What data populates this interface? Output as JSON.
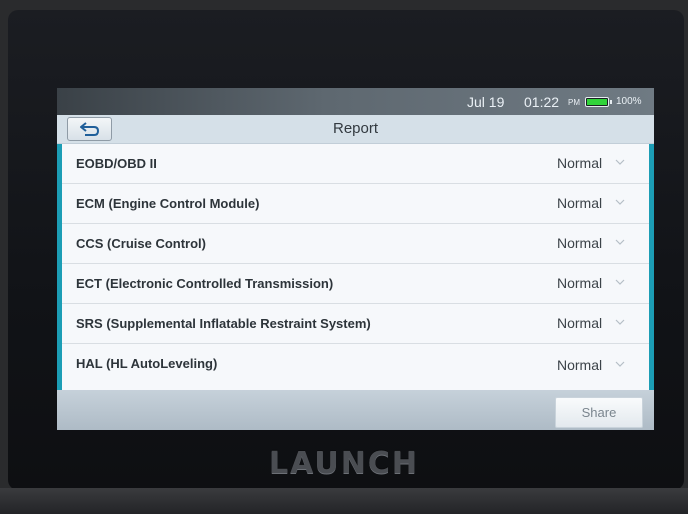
{
  "status_bar": {
    "date": "Jul 19",
    "time": "01:22",
    "ampm": "PM",
    "battery": "100%",
    "battery_icon": "battery-icon",
    "battery_color": "#31d33a"
  },
  "header": {
    "title": "Report",
    "back_icon": "back-arrow-icon"
  },
  "systems": [
    {
      "label": "EOBD/OBD II",
      "status": "Normal"
    },
    {
      "label": "ECM (Engine Control Module)",
      "status": "Normal"
    },
    {
      "label": "CCS (Cruise Control)",
      "status": "Normal"
    },
    {
      "label": "ECT (Electronic Controlled Transmission)",
      "status": "Normal"
    },
    {
      "label": "SRS (Supplemental Inflatable Restraint System)",
      "status": "Normal"
    },
    {
      "label": "HAL (HL AutoLeveling)",
      "status": "Normal"
    }
  ],
  "footer": {
    "share_label": "Share"
  },
  "device": {
    "brand": "LAUNCH"
  },
  "colors": {
    "accent": "#1c9db5",
    "title_bar": "#d5e0e8"
  }
}
